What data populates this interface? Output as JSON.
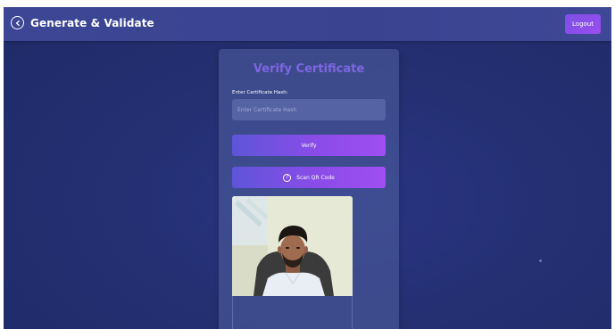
{
  "app": {
    "title": "Generate & Validate",
    "brand_icon": "circle-arrow-icon"
  },
  "header": {
    "logout_label": "Logout"
  },
  "verify_card": {
    "title": "Verify Certificate",
    "hash_label": "Enter Certificate Hash:",
    "hash_placeholder": "Enter Certificate Hash",
    "hash_value": "",
    "verify_label": "Verify",
    "scan_label": "Scan QR Code",
    "scan_icon": "qr-scan-icon"
  },
  "camera": {
    "icon": "webcam-feed"
  },
  "colors": {
    "background": "#243072",
    "navbar": "#3c4694",
    "accent": "#8a4ce8",
    "title_purple": "#7e66e0"
  }
}
